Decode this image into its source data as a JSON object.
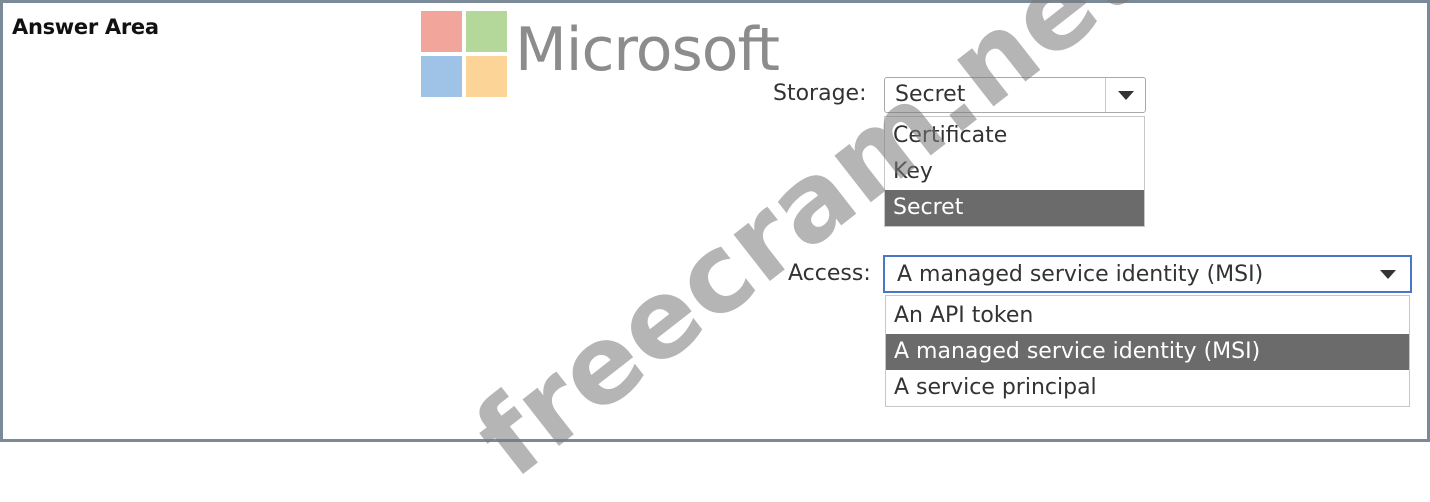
{
  "answer_area": {
    "title": "Answer Area"
  },
  "logo": {
    "text": "Microsoft",
    "colors": [
      "#f2a59b",
      "#b4d79a",
      "#9fc3e6",
      "#fdd498"
    ]
  },
  "watermark": {
    "text": "freecram.net"
  },
  "storage": {
    "label": "Storage:",
    "selected_value": "Secret",
    "options": [
      {
        "label": "Certificate",
        "selected": false
      },
      {
        "label": "Key",
        "selected": false
      },
      {
        "label": "Secret",
        "selected": true
      }
    ]
  },
  "access": {
    "label": "Access:",
    "selected_value": "A managed service identity (MSI)",
    "options": [
      {
        "label": "An API token",
        "selected": false
      },
      {
        "label": "A managed service identity (MSI)",
        "selected": true
      },
      {
        "label": "A service principal",
        "selected": false
      }
    ]
  },
  "colors": {
    "selected_option_bg": "#6b6b6b",
    "frame_border": "#7a8a99",
    "focus_border": "#4a76c8"
  }
}
